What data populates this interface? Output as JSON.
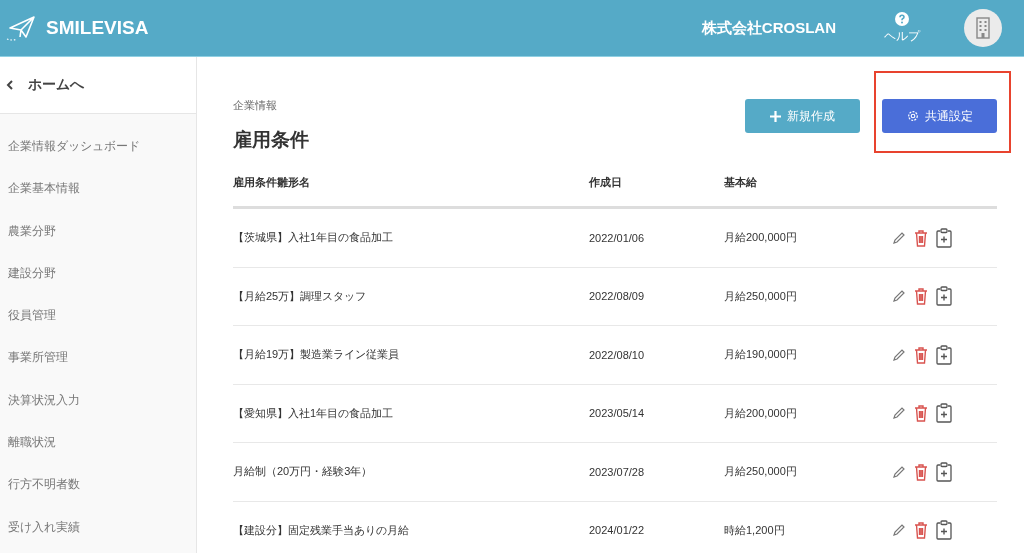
{
  "header": {
    "brand": "SMILEVISA",
    "company": "株式会社CROSLAN",
    "help_label": "ヘルプ"
  },
  "sidebar": {
    "back_label": "ホームへ",
    "items": [
      {
        "label": "企業情報ダッシュボード",
        "selected": false
      },
      {
        "label": "企業基本情報",
        "selected": false
      },
      {
        "label": "農業分野",
        "selected": false
      },
      {
        "label": "建設分野",
        "selected": false
      },
      {
        "label": "役員管理",
        "selected": false
      },
      {
        "label": "事業所管理",
        "selected": false
      },
      {
        "label": "決算状況入力",
        "selected": false
      },
      {
        "label": "離職状況",
        "selected": false
      },
      {
        "label": "行方不明者数",
        "selected": false
      },
      {
        "label": "受け入れ実績",
        "selected": false
      }
    ]
  },
  "page": {
    "breadcrumb": "企業情報",
    "title": "雇用条件"
  },
  "buttons": [
    {
      "kind": "create",
      "label": "新規作成",
      "highlighted": false
    },
    {
      "kind": "settings",
      "label": "共通設定",
      "highlighted": true
    }
  ],
  "table": {
    "columns": [
      "雇用条件雛形名",
      "作成日",
      "基本給"
    ],
    "rows": [
      {
        "name": "【茨城県】入社1年目の食品加工",
        "date": "2022/01/06",
        "salary": "月給200,000円"
      },
      {
        "name": "【月給25万】調理スタッフ",
        "date": "2022/08/09",
        "salary": "月給250,000円"
      },
      {
        "name": "【月給19万】製造業ライン従業員",
        "date": "2022/08/10",
        "salary": "月給190,000円"
      },
      {
        "name": "【愛知県】入社1年目の食品加工",
        "date": "2023/05/14",
        "salary": "月給200,000円"
      },
      {
        "name": "月給制（20万円・経験3年）",
        "date": "2023/07/28",
        "salary": "月給250,000円"
      },
      {
        "name": "【建設分】固定残業手当ありの月給",
        "date": "2024/01/22",
        "salary": "時給1,200円"
      }
    ]
  }
}
